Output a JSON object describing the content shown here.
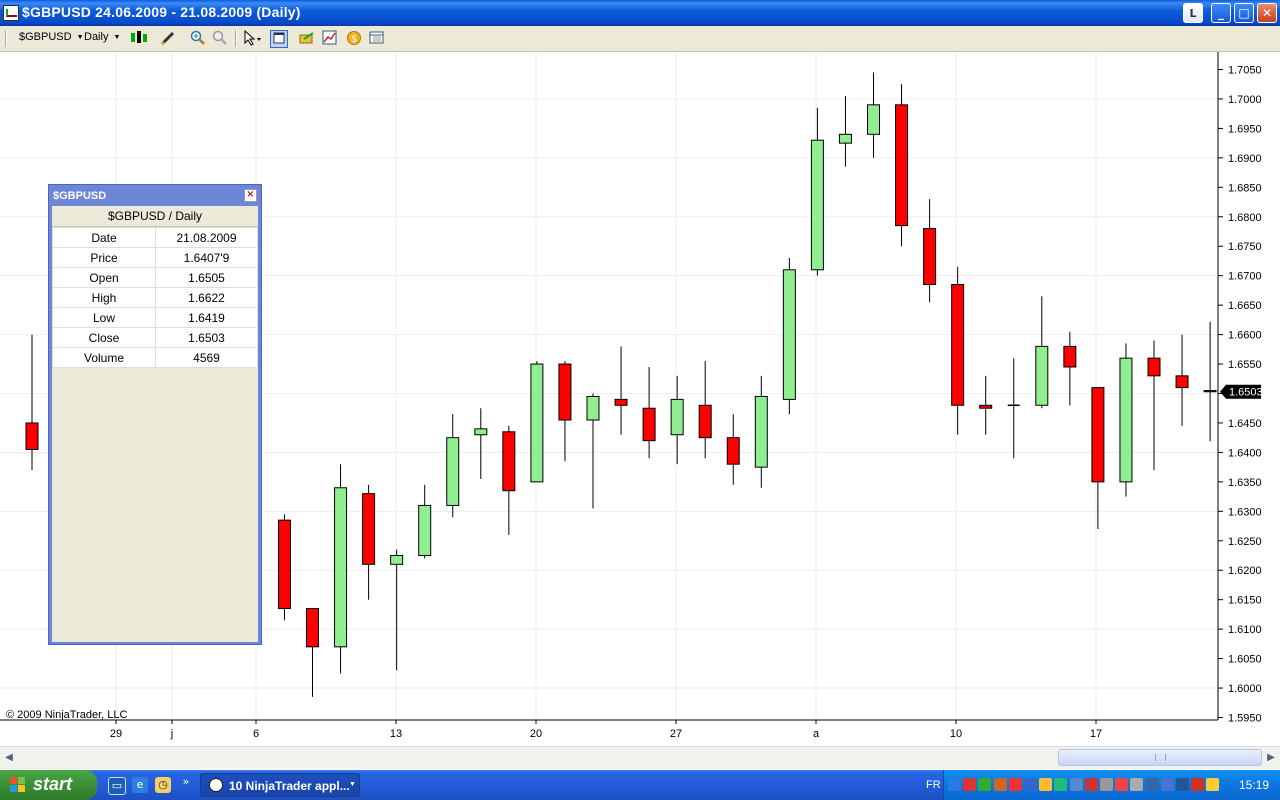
{
  "window": {
    "title": "$GBPUSD  24.06.2009 - 21.08.2009 (Daily)",
    "buttons": {
      "l": "L",
      "minimize": "_",
      "maximize": "□",
      "close": "✕"
    }
  },
  "toolbar": {
    "instrument": "$GBPUSD",
    "interval": "Daily"
  },
  "copyright": "© 2009 NinjaTrader, LLC",
  "data_box": {
    "title": "$GBPUSD",
    "header": "$GBPUSD / Daily",
    "rows": [
      {
        "label": "Date",
        "value": "21.08.2009"
      },
      {
        "label": "Price",
        "value": "1.6407'9"
      },
      {
        "label": "Open",
        "value": "1.6505"
      },
      {
        "label": "High",
        "value": "1.6622"
      },
      {
        "label": "Low",
        "value": "1.6419"
      },
      {
        "label": "Close",
        "value": "1.6503"
      },
      {
        "label": "Volume",
        "value": "4569"
      }
    ]
  },
  "chart_data": {
    "type": "candlestick",
    "ylim": [
      1.595,
      1.7065
    ],
    "yticks": [
      "1.7050",
      "1.7000",
      "1.6950",
      "1.6900",
      "1.6850",
      "1.6800",
      "1.6750",
      "1.6700",
      "1.6650",
      "1.6600",
      "1.6550",
      "1.6500",
      "1.6450",
      "1.6400",
      "1.6350",
      "1.6300",
      "1.6250",
      "1.6200",
      "1.6150",
      "1.6100",
      "1.6050",
      "1.6000",
      "1.5950"
    ],
    "xticks": [
      {
        "label": "29",
        "day": 1
      },
      {
        "label": "j",
        "day": 3
      },
      {
        "label": "6",
        "day": 6
      },
      {
        "label": "13",
        "day": 11
      },
      {
        "label": "20",
        "day": 16
      },
      {
        "label": "27",
        "day": 21
      },
      {
        "label": "a",
        "day": 26
      },
      {
        "label": "10",
        "day": 31
      },
      {
        "label": "17",
        "day": 36
      }
    ],
    "last_price": "1.6503",
    "colors": {
      "up": "#90ee90",
      "down": "#ff0000",
      "grid": "#eeeeee",
      "outline": "#000000"
    },
    "candles": [
      {
        "o": 1.645,
        "h": 1.66,
        "l": 1.637,
        "c": 1.6405
      },
      {
        "o": 1.6285,
        "h": 1.6295,
        "l": 1.6115,
        "c": 1.6135
      },
      {
        "o": 1.6135,
        "h": 1.6135,
        "l": 1.5985,
        "c": 1.607
      },
      {
        "o": 1.607,
        "h": 1.638,
        "l": 1.6025,
        "c": 1.634
      },
      {
        "o": 1.633,
        "h": 1.6345,
        "l": 1.615,
        "c": 1.621
      },
      {
        "o": 1.621,
        "h": 1.6235,
        "l": 1.603,
        "c": 1.6225
      },
      {
        "o": 1.6225,
        "h": 1.6345,
        "l": 1.622,
        "c": 1.631
      },
      {
        "o": 1.631,
        "h": 1.6465,
        "l": 1.629,
        "c": 1.6425
      },
      {
        "o": 1.643,
        "h": 1.6475,
        "l": 1.6355,
        "c": 1.644
      },
      {
        "o": 1.6435,
        "h": 1.6445,
        "l": 1.626,
        "c": 1.6335
      },
      {
        "o": 1.635,
        "h": 1.6555,
        "l": 1.635,
        "c": 1.655
      },
      {
        "o": 1.655,
        "h": 1.6555,
        "l": 1.6385,
        "c": 1.6455
      },
      {
        "o": 1.6455,
        "h": 1.65,
        "l": 1.6305,
        "c": 1.6495
      },
      {
        "o": 1.649,
        "h": 1.658,
        "l": 1.643,
        "c": 1.648
      },
      {
        "o": 1.6475,
        "h": 1.6545,
        "l": 1.639,
        "c": 1.642
      },
      {
        "o": 1.643,
        "h": 1.653,
        "l": 1.638,
        "c": 1.649
      },
      {
        "o": 1.648,
        "h": 1.6555,
        "l": 1.639,
        "c": 1.6425
      },
      {
        "o": 1.6425,
        "h": 1.6465,
        "l": 1.6345,
        "c": 1.638
      },
      {
        "o": 1.6375,
        "h": 1.653,
        "l": 1.634,
        "c": 1.6495
      },
      {
        "o": 1.649,
        "h": 1.673,
        "l": 1.6465,
        "c": 1.671
      },
      {
        "o": 1.671,
        "h": 1.6985,
        "l": 1.67,
        "c": 1.693
      },
      {
        "o": 1.6925,
        "h": 1.7005,
        "l": 1.6885,
        "c": 1.694
      },
      {
        "o": 1.694,
        "h": 1.7045,
        "l": 1.69,
        "c": 1.699
      },
      {
        "o": 1.699,
        "h": 1.7025,
        "l": 1.675,
        "c": 1.6785
      },
      {
        "o": 1.678,
        "h": 1.683,
        "l": 1.6655,
        "c": 1.6685
      },
      {
        "o": 1.6685,
        "h": 1.6715,
        "l": 1.643,
        "c": 1.648
      },
      {
        "o": 1.648,
        "h": 1.653,
        "l": 1.643,
        "c": 1.6475
      },
      {
        "o": 1.648,
        "h": 1.656,
        "l": 1.639,
        "c": 1.648
      },
      {
        "o": 1.648,
        "h": 1.6665,
        "l": 1.6475,
        "c": 1.658
      },
      {
        "o": 1.658,
        "h": 1.6605,
        "l": 1.648,
        "c": 1.6545
      },
      {
        "o": 1.651,
        "h": 1.651,
        "l": 1.627,
        "c": 1.635
      },
      {
        "o": 1.635,
        "h": 1.6585,
        "l": 1.6325,
        "c": 1.656
      },
      {
        "o": 1.656,
        "h": 1.659,
        "l": 1.637,
        "c": 1.653
      },
      {
        "o": 1.653,
        "h": 1.66,
        "l": 1.6445,
        "c": 1.651
      },
      {
        "o": 1.6505,
        "h": 1.6622,
        "l": 1.6419,
        "c": 1.6503
      }
    ],
    "candle_days": [
      0,
      9,
      10,
      11,
      12,
      13,
      14,
      15,
      16,
      17,
      18,
      19,
      20,
      21,
      22,
      23,
      24,
      25,
      26,
      27,
      28,
      29,
      30,
      31,
      32,
      33,
      34,
      35,
      36,
      37,
      38,
      39,
      40,
      41,
      42,
      43
    ]
  },
  "taskbar": {
    "start_label": "start",
    "task_label": "10 NinjaTrader appl...",
    "lang": "FR",
    "clock": "15:19"
  }
}
